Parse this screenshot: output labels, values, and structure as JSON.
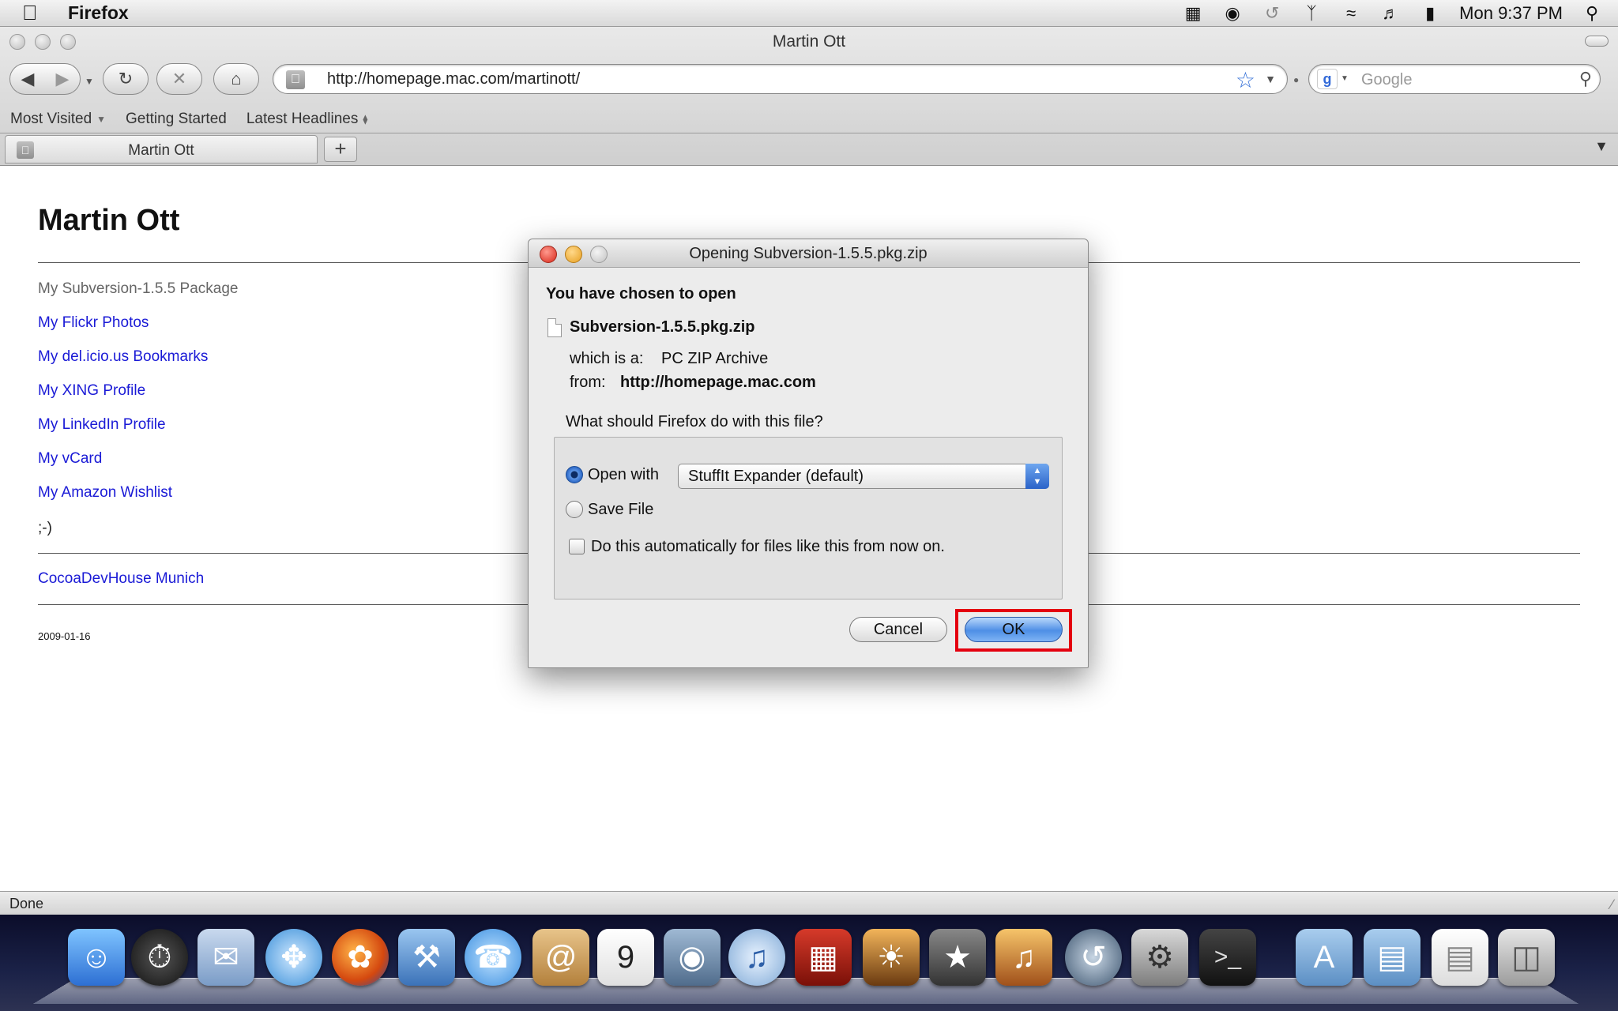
{
  "menubar": {
    "app_name": "Firefox",
    "clock": "Mon 9:37 PM"
  },
  "window": {
    "title": "Martin Ott"
  },
  "toolbar": {
    "url": "http://homepage.mac.com/martinott/",
    "search_placeholder": "Google"
  },
  "bookmarks": {
    "items": [
      {
        "label": "Most Visited"
      },
      {
        "label": "Getting Started"
      },
      {
        "label": "Latest Headlines"
      }
    ]
  },
  "tabs": {
    "active_title": "Martin Ott"
  },
  "page": {
    "title": "Martin Ott",
    "package_text": "My Subversion-1.5.5 Package",
    "links": [
      {
        "label": "My Flickr Photos"
      },
      {
        "label": "My del.icio.us Bookmarks"
      },
      {
        "label": "My XING Profile"
      },
      {
        "label": "My LinkedIn Profile"
      },
      {
        "label": "My vCard"
      },
      {
        "label": "My Amazon Wishlist"
      }
    ],
    "smiley": ";-)",
    "footer_link": "CocoaDevHouse Munich",
    "date": "2009-01-16"
  },
  "status": {
    "text": "Done"
  },
  "dialog": {
    "title": "Opening Subversion-1.5.5.pkg.zip",
    "chosen_heading": "You have chosen to open",
    "filename": "Subversion-1.5.5.pkg.zip",
    "which_label": "which is a:",
    "which_value": "PC ZIP Archive",
    "from_label": "from:",
    "from_value": "http://homepage.mac.com",
    "question": "What should Firefox do with this file?",
    "open_with_label": "Open with",
    "open_with_app": "StuffIt Expander (default)",
    "save_file_label": "Save File",
    "auto_label": "Do this automatically for files like this from now on.",
    "cancel_label": "Cancel",
    "ok_label": "OK"
  }
}
